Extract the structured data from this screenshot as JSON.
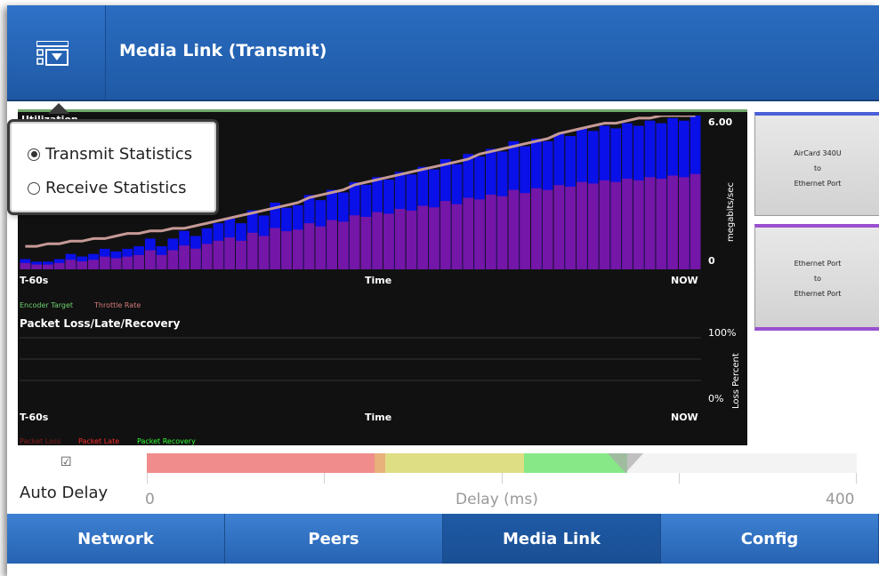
{
  "app": {
    "title": "Media Link (Transmit)"
  },
  "stats_popup": {
    "options": [
      {
        "label": "Transmit Statistics",
        "selected": true
      },
      {
        "label": "Receive Statistics",
        "selected": false
      }
    ]
  },
  "utilization_chart": {
    "title": "Utilization",
    "x_start": "T-60s",
    "x_label": "Time",
    "x_end": "NOW",
    "y_max": "6.00",
    "y_min": "0",
    "y_label": "megabits/sec",
    "legend": [
      {
        "label": "Encoder Target",
        "color": "#6fd36f"
      },
      {
        "label": "Throttle Rate",
        "color": "#d47a7a"
      }
    ],
    "colors": {
      "blue": "#0a10e8",
      "purple": "#7416a8",
      "line": "#c69a96"
    }
  },
  "loss_chart": {
    "title": "Packet Loss/Late/Recovery",
    "x_start": "T-60s",
    "x_label": "Time",
    "x_end": "NOW",
    "y_max": "100%",
    "y_min": "0%",
    "y_label": "Loss Percent",
    "legend": [
      {
        "label": "Packet Loss",
        "color": "#8b1a1a"
      },
      {
        "label": "Packet Late",
        "color": "#ff2a2a"
      },
      {
        "label": "Packet Recovery",
        "color": "#33ff33"
      }
    ]
  },
  "ports": [
    {
      "lines": [
        "AirCard 340U",
        "to",
        "Ethernet Port"
      ],
      "accent": "#4a5fd8"
    },
    {
      "lines": [
        "Ethernet Port",
        "to",
        "Ethernet Port"
      ],
      "accent": "#9a4fd0"
    }
  ],
  "delay": {
    "auto_label": "Auto Delay",
    "auto_checked": true,
    "min_label": "0",
    "axis_label": "Delay (ms)",
    "max_label": "400",
    "slider_value_fraction": 0.68
  },
  "tabs": [
    {
      "label": "Network",
      "active": false
    },
    {
      "label": "Peers",
      "active": false
    },
    {
      "label": "Media Link",
      "active": true
    },
    {
      "label": "Config",
      "active": false
    }
  ],
  "chart_data": {
    "type": "bar",
    "title": "Utilization",
    "xlabel": "Time",
    "ylabel": "megabits/sec",
    "ylim": [
      0,
      6
    ],
    "x_range": [
      "T-60s",
      "NOW"
    ],
    "series": [
      {
        "name": "Encoder Target",
        "values": [
          0.4,
          0.3,
          0.3,
          0.4,
          0.6,
          0.5,
          0.6,
          0.8,
          0.7,
          0.8,
          0.9,
          1.2,
          0.9,
          1.2,
          1.5,
          1.3,
          1.6,
          1.8,
          2.0,
          1.8,
          2.3,
          2.1,
          2.6,
          2.4,
          2.5,
          2.9,
          2.7,
          3.1,
          3.0,
          3.4,
          3.3,
          3.6,
          3.5,
          3.8,
          3.7,
          4.0,
          3.9,
          4.3,
          4.1,
          4.5,
          4.4,
          4.7,
          4.6,
          5.0,
          4.8,
          5.1,
          5.0,
          5.3,
          5.2,
          5.5,
          5.4,
          5.6,
          5.5,
          5.7,
          5.6,
          5.8,
          5.7,
          5.9,
          5.8,
          6.0
        ]
      },
      {
        "name": "Throttle Rate",
        "values": [
          0.9,
          0.9,
          1.0,
          1.0,
          1.1,
          1.1,
          1.2,
          1.2,
          1.3,
          1.4,
          1.4,
          1.5,
          1.5,
          1.6,
          1.6,
          1.7,
          1.8,
          1.9,
          2.0,
          2.1,
          2.2,
          2.3,
          2.4,
          2.5,
          2.6,
          2.8,
          2.9,
          3.0,
          3.1,
          3.3,
          3.4,
          3.5,
          3.6,
          3.7,
          3.8,
          3.9,
          4.0,
          4.1,
          4.2,
          4.3,
          4.5,
          4.6,
          4.7,
          4.8,
          4.9,
          5.0,
          5.1,
          5.3,
          5.4,
          5.5,
          5.6,
          5.7,
          5.7,
          5.8,
          5.9,
          5.9,
          6.0,
          6.0,
          6.0,
          6.0
        ]
      }
    ]
  }
}
